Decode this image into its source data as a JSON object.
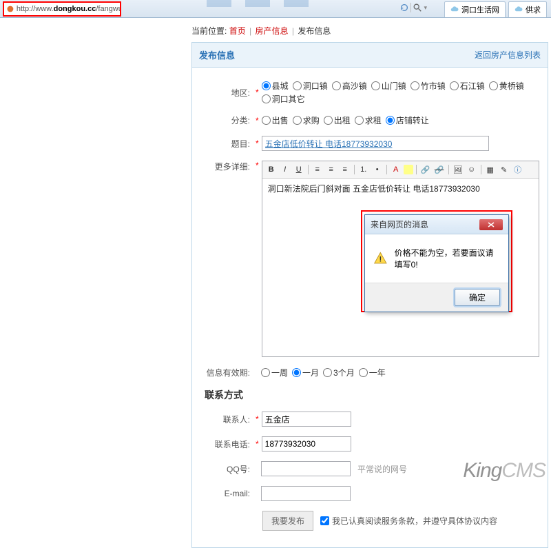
{
  "browser": {
    "url_prefix": "http://www.",
    "url_bold": "dongkou.cc",
    "url_suffix": "/fangwu/edit/",
    "search_hint": "",
    "tab1": "洞口生活网",
    "tab2": "供求"
  },
  "breadcrumb": {
    "label": "当前位置:",
    "home": "首页",
    "cat": "房产信息",
    "page": "发布信息"
  },
  "panel": {
    "title": "发布信息",
    "back": "返回房产信息列表"
  },
  "form": {
    "region_label": "地区:",
    "regions": [
      "县城",
      "洞口镇",
      "高沙镇",
      "山门镇",
      "竹市镇",
      "石江镇",
      "黄桥镇",
      "洞口其它"
    ],
    "cat_label": "分类:",
    "cats": [
      "出售",
      "求购",
      "出租",
      "求租",
      "店铺转让"
    ],
    "title_label": "题目:",
    "title_value": "五金店低价转让 电话18773932030",
    "detail_label": "更多详细:",
    "detail_value": "洞口新法院后门斜对面 五金店低价转让 电话18773932030",
    "expire_label": "信息有效期:",
    "expires": [
      "一周",
      "一月",
      "3个月",
      "一年"
    ]
  },
  "dialog": {
    "title": "来自网页的消息",
    "msg": "价格不能为空，若要面议请填写0!",
    "ok": "确定"
  },
  "contact": {
    "heading": "联系方式",
    "name_label": "联系人:",
    "name_value": "五金店",
    "phone_label": "联系电话:",
    "phone_value": "18773932030",
    "qq_label": "QQ号:",
    "qq_hint": "平常说的网号",
    "email_label": "E-mail:"
  },
  "submit": {
    "btn": "我要发布",
    "agree": "我已认真阅读服务条款，并遵守具体协议内容"
  },
  "watermark": {
    "a": "King",
    "b": "CMS"
  }
}
